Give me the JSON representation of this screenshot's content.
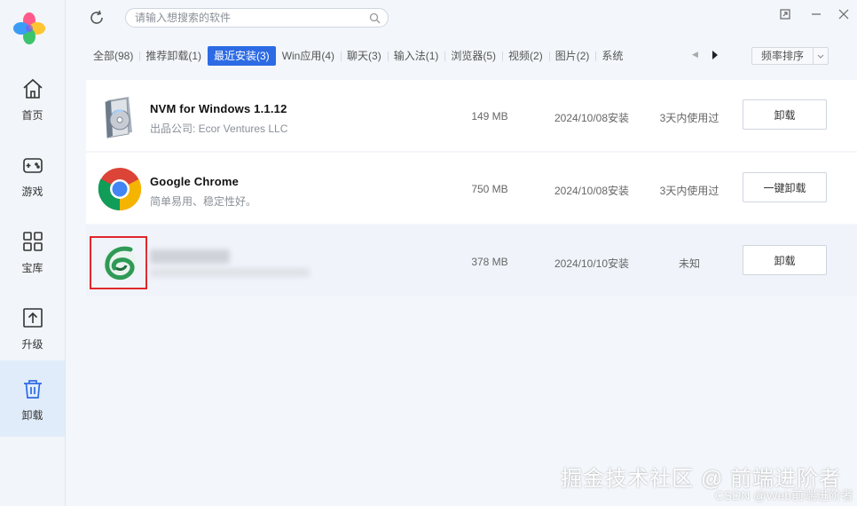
{
  "sidebar": {
    "items": [
      {
        "label": "首页",
        "icon": "home-icon"
      },
      {
        "label": "游戏",
        "icon": "gamepad-icon"
      },
      {
        "label": "宝库",
        "icon": "grid-icon"
      },
      {
        "label": "升级",
        "icon": "upgrade-icon"
      },
      {
        "label": "卸载",
        "icon": "trash-icon"
      }
    ],
    "active_index": 4
  },
  "search": {
    "placeholder": "请输入想搜索的软件"
  },
  "tabs": [
    {
      "label": "全部(98)"
    },
    {
      "label": "推荐卸载(1)"
    },
    {
      "label": "最近安装(3)"
    },
    {
      "label": "Win应用(4)"
    },
    {
      "label": "聊天(3)"
    },
    {
      "label": "输入法(1)"
    },
    {
      "label": "浏览器(5)"
    },
    {
      "label": "视频(2)"
    },
    {
      "label": "图片(2)"
    },
    {
      "label": "系统"
    }
  ],
  "active_tab_index": 2,
  "sort": {
    "label": "频率排序"
  },
  "apps": [
    {
      "name": "NVM for Windows 1.1.12",
      "desc": "出品公司: Ecor Ventures LLC",
      "size": "149 MB",
      "date": "2024/10/08安装",
      "usage": "3天内使用过",
      "action": "卸载"
    },
    {
      "name": "Google Chrome",
      "desc": "简单易用、稳定性好。",
      "size": "750 MB",
      "date": "2024/10/08安装",
      "usage": "3天内使用过",
      "action": "一键卸载"
    },
    {
      "name": "",
      "desc": "",
      "size": "378 MB",
      "date": "2024/10/10安装",
      "usage": "未知",
      "action": "卸载"
    }
  ],
  "watermark": {
    "main": "掘金技术社区 @ 前端进阶者",
    "sub": "CSDN @Web前端进阶者"
  },
  "colors": {
    "accent": "#2d6be4",
    "highlight_border": "#e0262b",
    "sidebar_active": "#e1ecfa"
  }
}
